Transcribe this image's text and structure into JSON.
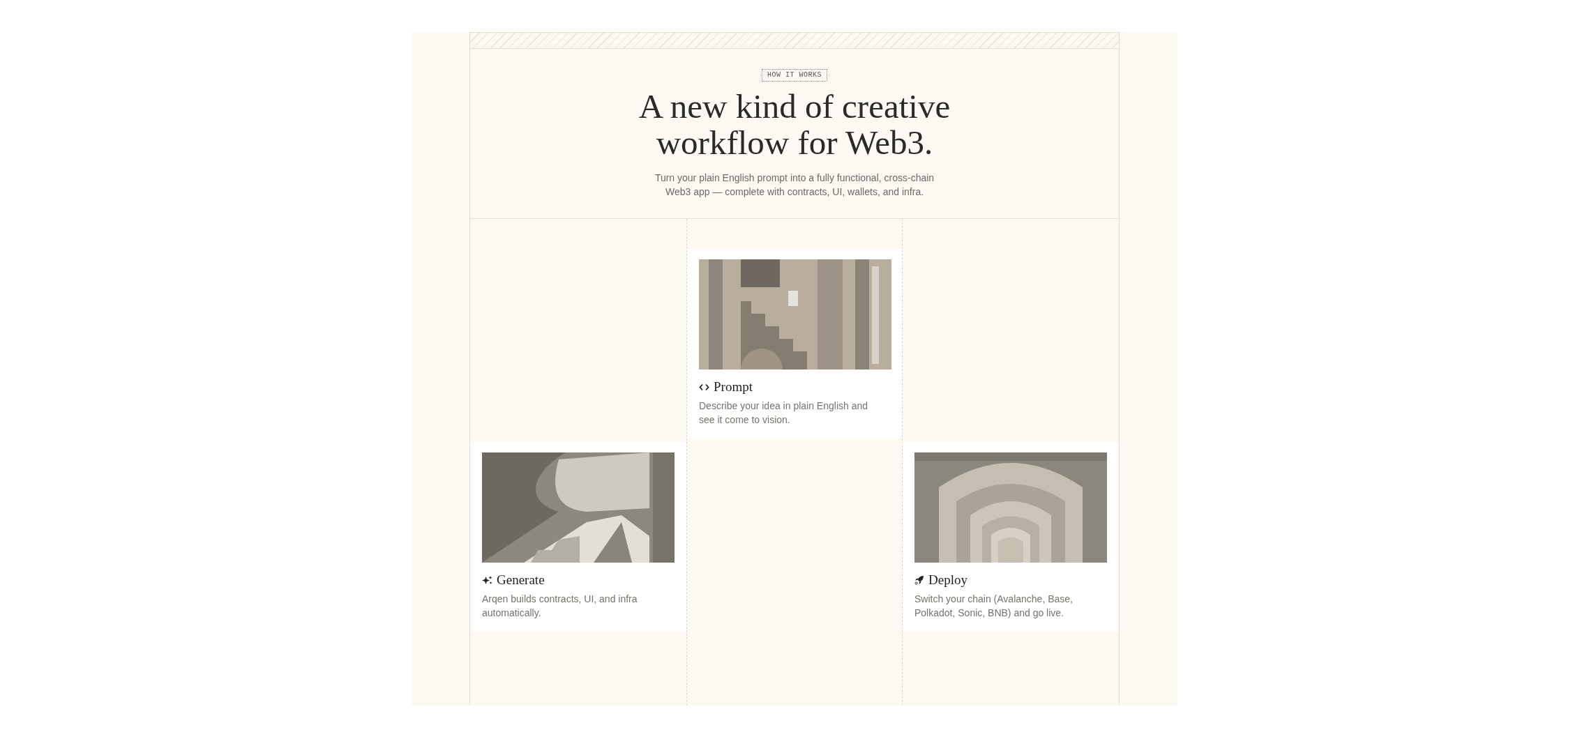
{
  "badge": "HOW IT WORKS",
  "heading": "A new kind of creative workflow for Web3.",
  "subtitle": "Turn your plain English prompt into a fully functional, cross-chain Web3 app — complete with contracts, UI, wallets, and infra.",
  "steps": [
    {
      "title": "Prompt",
      "description": "Describe your idea in plain English and see it come to vision."
    },
    {
      "title": "Generate",
      "description": "Arqen builds contracts, UI, and infra automatically."
    },
    {
      "title": "Deploy",
      "description": "Switch your chain (Avalanche, Base, Polkadot, Sonic, BNB) and go live."
    }
  ]
}
